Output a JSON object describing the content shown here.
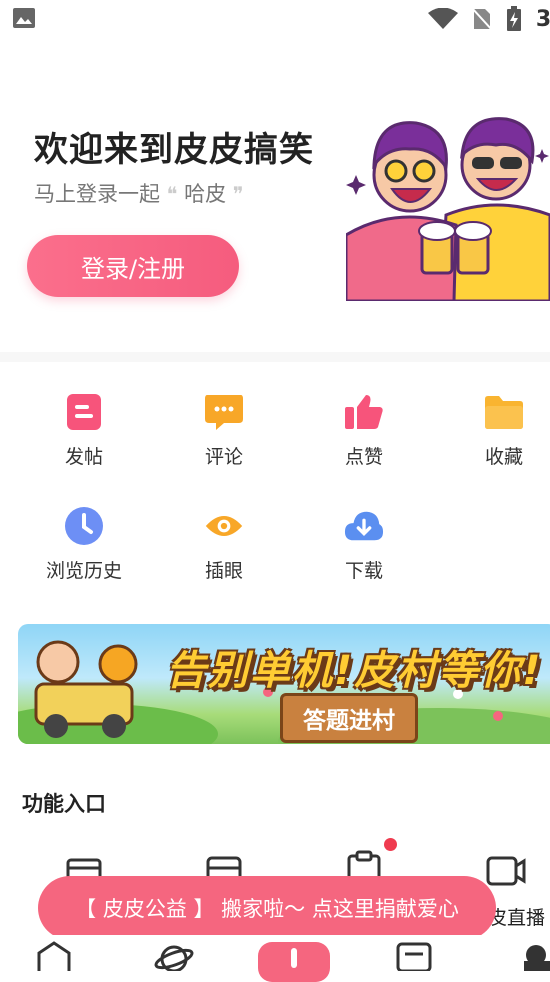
{
  "status_bar": {
    "time": "3:",
    "icons": [
      "image-icon",
      "wifi-icon",
      "no-sim-icon",
      "battery-charging-icon"
    ]
  },
  "header": {
    "welcome_text": "欢迎来到皮皮搞笑",
    "subtitle_prefix": "马上登录一起",
    "subtitle_open_quote": "❝",
    "subtitle_word": "哈皮",
    "subtitle_close_quote": "❞",
    "login_button": "登录/注册"
  },
  "quick_actions": [
    {
      "label": "发帖",
      "icon": "post-icon",
      "color": "#f7547b"
    },
    {
      "label": "评论",
      "icon": "comment-icon",
      "color": "#f8a728"
    },
    {
      "label": "点赞",
      "icon": "thumbs-up-icon",
      "color": "#f7547b"
    },
    {
      "label": "收藏",
      "icon": "folder-icon",
      "color": "#f9b430"
    },
    {
      "label": "浏览历史",
      "icon": "clock-icon",
      "color": "#6d8ff5"
    },
    {
      "label": "插眼",
      "icon": "eye-icon",
      "color": "#f8a728"
    },
    {
      "label": "下载",
      "icon": "download-cloud-icon",
      "color": "#5b8ff0"
    }
  ],
  "banner": {
    "title": "告别单机!皮村等你!",
    "button": "答题进村"
  },
  "features": {
    "section_title": "功能入口",
    "visible_label": "皮直播"
  },
  "toast": {
    "text": "【 皮皮公益 】 搬家啦～ 点这里捐献爱心"
  },
  "colors": {
    "accent": "#f5667f",
    "notification_dot": "#ef3b4f"
  }
}
